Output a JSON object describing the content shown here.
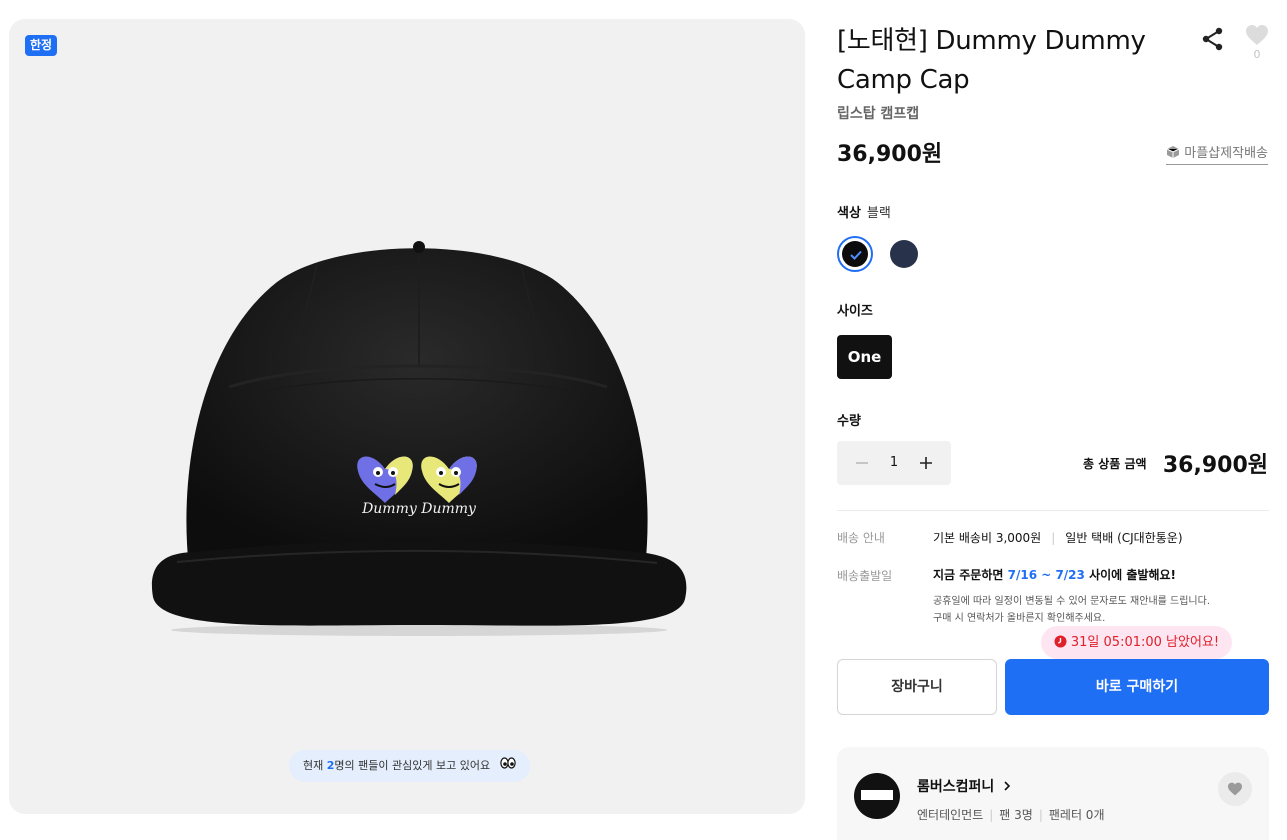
{
  "image": {
    "badge": "한정",
    "viewer_prefix": "현재 ",
    "viewer_count": "2",
    "viewer_suffix": "명의 팬들이 관심있게 보고 있어요",
    "cap_logo_text": "Dummy Dummy"
  },
  "product": {
    "title": "[노태현] Dummy Dummy Camp Cap",
    "subtitle": "립스탑 캠프캡",
    "price": "36,900원",
    "like_count": "0",
    "shipping_link": "마플샵제작배송"
  },
  "options": {
    "color_label": "색상",
    "color_selected": "블랙",
    "colors": [
      {
        "name": "black",
        "hex": "#0c0c0c",
        "selected": true
      },
      {
        "name": "navy",
        "hex": "#28324a",
        "selected": false
      }
    ],
    "size_label": "사이즈",
    "size_selected": "One",
    "qty_label": "수량",
    "qty": "1"
  },
  "total": {
    "label": "총 상품 금액",
    "value": "36,900원"
  },
  "delivery": {
    "info_key": "배송 안내",
    "info_fee": "기본 배송비 3,000원",
    "info_courier": "일반 택배 (CJ대한통운)",
    "ship_key": "배송출발일",
    "ship_prefix": "지금 주문하면 ",
    "ship_dates": "7/16 ~ 7/23",
    "ship_suffix": " 사이에 출발해요!",
    "notice_line1": "공휴일에 따라 일정이 변동될 수 있어 문자로도 재안내를 드립니다.",
    "notice_line2": "구매 시 연락처가 올바른지 확인해주세요."
  },
  "countdown": "31일 05:01:00 남았어요!",
  "actions": {
    "cart": "장바구니",
    "buy": "바로 구매하기"
  },
  "shop": {
    "name": "롬버스컴퍼니",
    "category": "엔터테인먼트",
    "fans": "팬 3명",
    "letters": "팬레터 0개"
  },
  "colors": {
    "accent": "#1f6ff5",
    "countdown_bg": "#fde6f2",
    "countdown_text": "#e0202a"
  }
}
